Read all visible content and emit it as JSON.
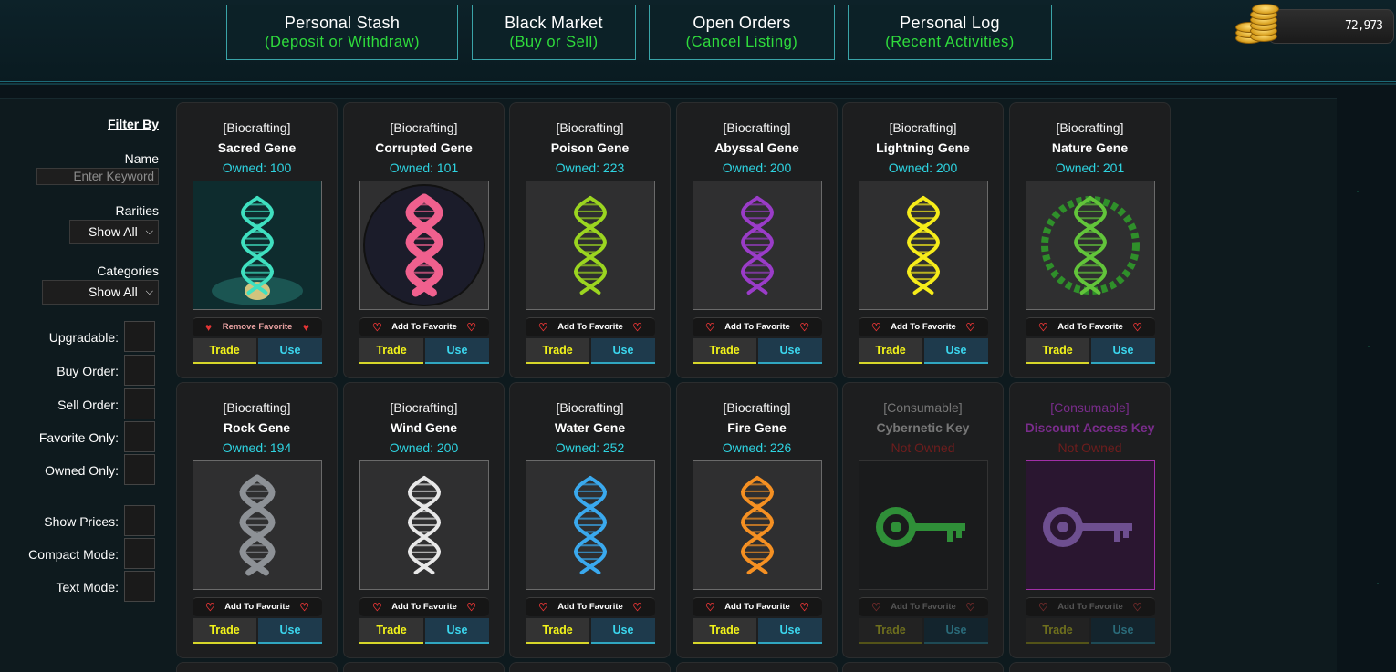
{
  "nav": [
    {
      "title": "Personal Stash",
      "subtitle": "(Deposit or Withdraw)"
    },
    {
      "title": "Black Market",
      "subtitle": "(Buy or Sell)"
    },
    {
      "title": "Open Orders",
      "subtitle": "(Cancel Listing)"
    },
    {
      "title": "Personal Log",
      "subtitle": "(Recent Activities)"
    }
  ],
  "wallet": {
    "amount": "72,973",
    "icon": "coin-stack-icon"
  },
  "filters": {
    "title": "Filter By",
    "name_label": "Name",
    "keyword_placeholder": "Enter Keyword",
    "rarities_label": "Rarities",
    "rarities_value": "Show All",
    "categories_label": "Categories",
    "categories_value": "Show All",
    "checkboxes": [
      {
        "label": "Upgradable:"
      },
      {
        "label": "Buy Order:"
      },
      {
        "label": "Sell Order:"
      },
      {
        "label": "Favorite Only:"
      },
      {
        "label": "Owned Only:"
      },
      {
        "label": "Show Prices:"
      },
      {
        "label": "Compact Mode:"
      },
      {
        "label": "Text Mode:"
      }
    ]
  },
  "buttons": {
    "trade": "Trade",
    "use": "Use"
  },
  "items": [
    {
      "category": "[Biocrafting]",
      "name": "Sacred Gene",
      "owned": "Owned: 100",
      "favorite": "Remove Favorite",
      "icon": "sacred-gene-icon",
      "color": "#3fe0c0"
    },
    {
      "category": "[Biocrafting]",
      "name": "Corrupted Gene",
      "owned": "Owned: 101",
      "favorite": "Add To Favorite",
      "icon": "corrupted-gene-icon",
      "color": "#f0608e"
    },
    {
      "category": "[Biocrafting]",
      "name": "Poison Gene",
      "owned": "Owned: 223",
      "favorite": "Add To Favorite",
      "icon": "poison-gene-icon",
      "color": "#9bd520"
    },
    {
      "category": "[Biocrafting]",
      "name": "Abyssal Gene",
      "owned": "Owned: 200",
      "favorite": "Add To Favorite",
      "icon": "abyssal-gene-icon",
      "color": "#9a3cc8"
    },
    {
      "category": "[Biocrafting]",
      "name": "Lightning Gene",
      "owned": "Owned: 200",
      "favorite": "Add To Favorite",
      "icon": "lightning-gene-icon",
      "color": "#f6ec1a"
    },
    {
      "category": "[Biocrafting]",
      "name": "Nature Gene",
      "owned": "Owned: 201",
      "favorite": "Add To Favorite",
      "icon": "nature-gene-icon",
      "color": "#62c43a"
    },
    {
      "category": "[Biocrafting]",
      "name": "Rock Gene",
      "owned": "Owned: 194",
      "favorite": "Add To Favorite",
      "icon": "rock-gene-icon",
      "color": "#8d9196"
    },
    {
      "category": "[Biocrafting]",
      "name": "Wind Gene",
      "owned": "Owned: 200",
      "favorite": "Add To Favorite",
      "icon": "wind-gene-icon",
      "color": "#e8e8e8"
    },
    {
      "category": "[Biocrafting]",
      "name": "Water Gene",
      "owned": "Owned: 252",
      "favorite": "Add To Favorite",
      "icon": "water-gene-icon",
      "color": "#3aa9ee"
    },
    {
      "category": "[Biocrafting]",
      "name": "Fire Gene",
      "owned": "Owned: 226",
      "favorite": "Add To Favorite",
      "icon": "fire-gene-icon",
      "color": "#f59022"
    },
    {
      "category": "[Consumable]",
      "name": "Cybernetic Key",
      "owned": "Not Owned",
      "favorite": "Add To Favorite",
      "icon": "cybernetic-key-icon",
      "color": "#2f8f38"
    },
    {
      "category": "[Consumable]",
      "name": "Discount Access Key",
      "owned": "Not Owned",
      "favorite": "Add To Favorite",
      "icon": "discount-access-key-icon",
      "color": "#6e4f90"
    }
  ]
}
